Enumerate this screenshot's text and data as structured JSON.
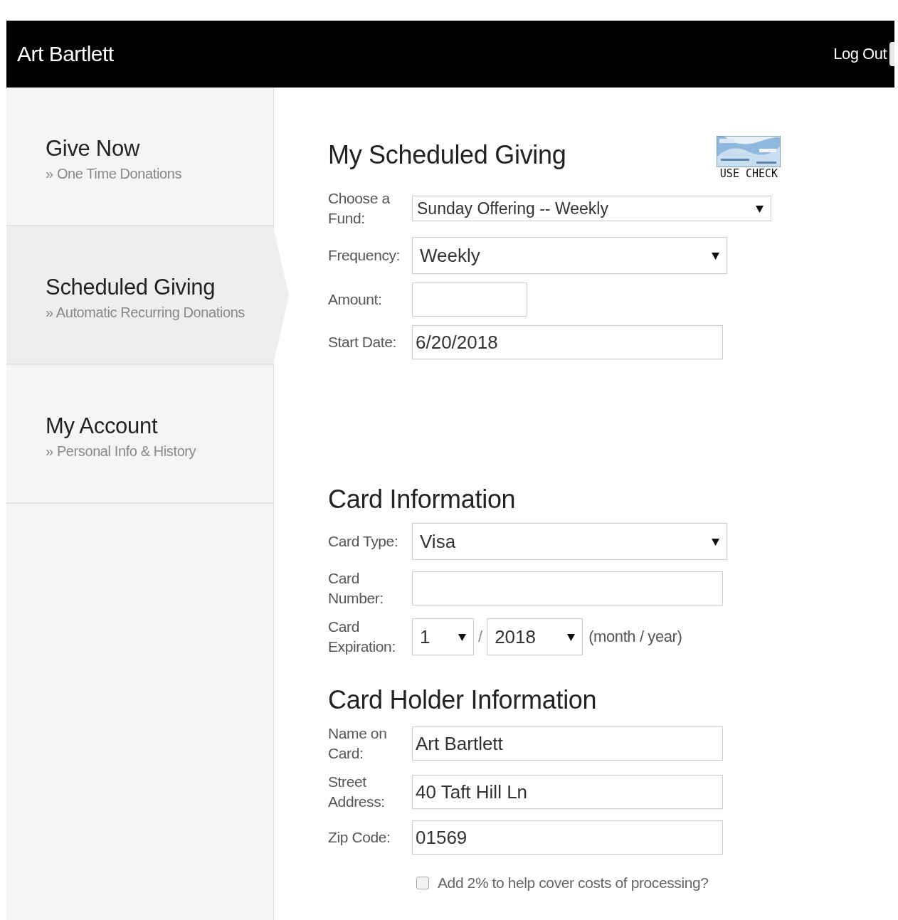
{
  "header": {
    "title": "Art Bartlett",
    "logout": "Log Out"
  },
  "sidebar": {
    "items": [
      {
        "title": "Give Now",
        "subtitle": "» One Time Donations",
        "selected": false
      },
      {
        "title": "Scheduled Giving",
        "subtitle": "» Automatic Recurring Donations",
        "selected": true
      },
      {
        "title": "My Account",
        "subtitle": "» Personal Info & History",
        "selected": false
      }
    ]
  },
  "scheduled_giving": {
    "heading": "My Scheduled Giving",
    "use_check": "USE CHECK",
    "fields": [
      {
        "kind": "select",
        "label": "Choose a Fund:",
        "value": "Sunday Offering -- Weekly"
      },
      {
        "kind": "select",
        "label": "Frequency:",
        "value": "Weekly"
      },
      {
        "kind": "input",
        "label": "Amount:"
      },
      {
        "kind": "input",
        "label": "Start Date:",
        "value": "6/20/2018"
      }
    ]
  },
  "card_information": {
    "heading": "Card Information",
    "fields": [
      {
        "kind": "select",
        "label": "Card Type:",
        "value": "Visa"
      },
      {
        "kind": "input",
        "label": "Card Number:"
      },
      {
        "kind": "expiry",
        "label": "Card Expiration:",
        "month": "1",
        "separator": "/",
        "year": "2018",
        "hint": "(month / year)"
      }
    ]
  },
  "card_holder_information": {
    "heading": "Card Holder Information",
    "fields": [
      {
        "kind": "input",
        "label": "Name on Card:",
        "value": "Art Bartlett"
      },
      {
        "kind": "input",
        "label": "Street Address:",
        "value": "40 Taft Hill Ln"
      },
      {
        "kind": "input",
        "label": "Zip Code:",
        "value": "01569"
      }
    ],
    "add_fee": {
      "label": "Add 2% to help cover costs of processing?",
      "checked": false
    }
  }
}
